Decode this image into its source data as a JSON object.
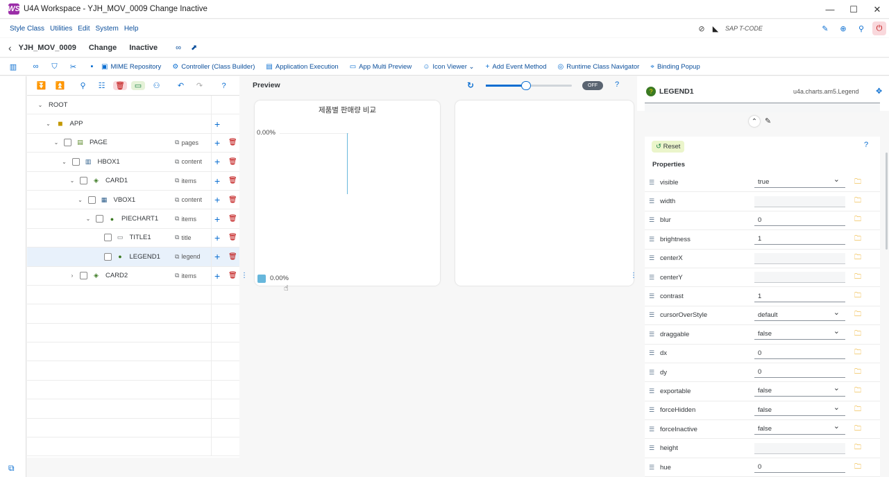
{
  "window": {
    "title": "U4A Workspace - YJH_MOV_0009 Change Inactive",
    "logo_text": "WS",
    "controls": [
      "—",
      "☐",
      "✕"
    ]
  },
  "menu": {
    "items": [
      "Style Class",
      "Utilities",
      "Edit",
      "System",
      "Help"
    ],
    "tcode_placeholder": "SAP T-CODE"
  },
  "header": {
    "back": "‹",
    "app_id": "YJH_MOV_0009",
    "mode": "Change",
    "status": "Inactive"
  },
  "toolbar": {
    "items": [
      {
        "icon": "▣",
        "label": "MIME Repository"
      },
      {
        "icon": "⚙",
        "label": "Controller (Class Builder)"
      },
      {
        "icon": "▤",
        "label": "Application Execution"
      },
      {
        "icon": "▭",
        "label": "App Multi Preview"
      },
      {
        "icon": "☺",
        "label": "Icon Viewer ⌄"
      },
      {
        "icon": "+",
        "label": "Add Event Method"
      },
      {
        "icon": "◎",
        "label": "Runtime Class Navigator"
      },
      {
        "icon": "⌖",
        "label": "Binding Popup"
      }
    ]
  },
  "tree": {
    "rows": [
      {
        "label": "ROOT",
        "depth": 0,
        "chev": "⌄",
        "checkbox": false,
        "icon": "",
        "agg": "",
        "plus": false,
        "del": false
      },
      {
        "label": "APP",
        "depth": 1,
        "chev": "⌄",
        "checkbox": false,
        "icon": "app",
        "agg": "",
        "plus": true,
        "del": false
      },
      {
        "label": "PAGE",
        "depth": 2,
        "chev": "⌄",
        "checkbox": true,
        "icon": "page",
        "agg": "pages",
        "plus": true,
        "del": true
      },
      {
        "label": "HBOX1",
        "depth": 3,
        "chev": "⌄",
        "checkbox": true,
        "icon": "hbox",
        "agg": "content",
        "plus": true,
        "del": true
      },
      {
        "label": "CARD1",
        "depth": 4,
        "chev": "⌄",
        "checkbox": true,
        "icon": "card",
        "agg": "items",
        "plus": true,
        "del": true
      },
      {
        "label": "VBOX1",
        "depth": 5,
        "chev": "⌄",
        "checkbox": true,
        "icon": "vbox",
        "agg": "content",
        "plus": true,
        "del": true
      },
      {
        "label": "PIECHART1",
        "depth": 6,
        "chev": "⌄",
        "checkbox": true,
        "icon": "chart",
        "agg": "items",
        "plus": true,
        "del": true
      },
      {
        "label": "TITLE1",
        "depth": 7,
        "chev": "",
        "checkbox": true,
        "icon": "title",
        "agg": "title",
        "plus": true,
        "del": true
      },
      {
        "label": "LEGEND1",
        "depth": 7,
        "chev": "",
        "checkbox": true,
        "icon": "chart",
        "agg": "legend",
        "plus": true,
        "del": true,
        "selected": true
      },
      {
        "label": "CARD2",
        "depth": 4,
        "chev": "›",
        "checkbox": true,
        "icon": "card",
        "agg": "items",
        "plus": true,
        "del": true
      }
    ]
  },
  "preview": {
    "label": "Preview",
    "toggle": "OFF",
    "chart_title": "제품별 판매량 비교",
    "value_top": "0.00%",
    "legend_value": "0.00%",
    "legend_color": "#67b7dc"
  },
  "props": {
    "element_name": "LEGEND1",
    "element_class": "u4a.charts.am5.Legend",
    "reset_label": "Reset",
    "section": "Properties",
    "rows": [
      {
        "name": "visible",
        "value": "true",
        "type": "select"
      },
      {
        "name": "width",
        "value": "",
        "type": "input"
      },
      {
        "name": "blur",
        "value": "0",
        "type": "input"
      },
      {
        "name": "brightness",
        "value": "1",
        "type": "input"
      },
      {
        "name": "centerX",
        "value": "",
        "type": "input"
      },
      {
        "name": "centerY",
        "value": "",
        "type": "input"
      },
      {
        "name": "contrast",
        "value": "1",
        "type": "input"
      },
      {
        "name": "cursorOverStyle",
        "value": "default",
        "type": "select"
      },
      {
        "name": "draggable",
        "value": "false",
        "type": "select"
      },
      {
        "name": "dx",
        "value": "0",
        "type": "input"
      },
      {
        "name": "dy",
        "value": "0",
        "type": "input"
      },
      {
        "name": "exportable",
        "value": "false",
        "type": "select"
      },
      {
        "name": "forceHidden",
        "value": "false",
        "type": "select"
      },
      {
        "name": "forceInactive",
        "value": "false",
        "type": "select"
      },
      {
        "name": "height",
        "value": "",
        "type": "input"
      },
      {
        "name": "hue",
        "value": "0",
        "type": "input"
      }
    ]
  }
}
